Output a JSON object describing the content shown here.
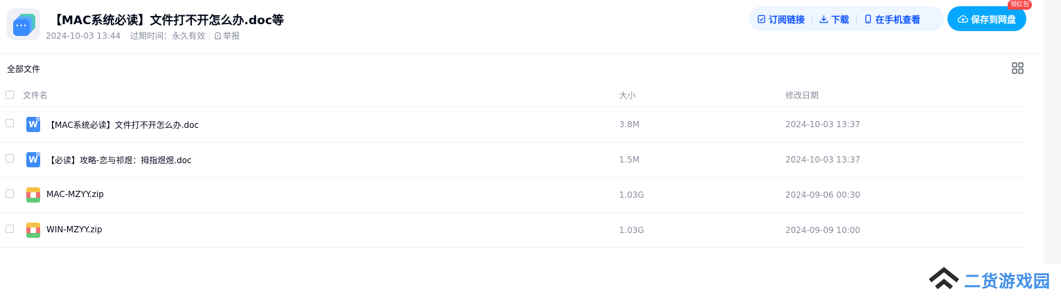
{
  "header": {
    "title": "【MAC系统必读】文件打不开怎么办.doc等",
    "share_date": "2024-10-03 13:44",
    "expiry_label": "过期时间：永久有效",
    "report_label": "举报"
  },
  "actions": {
    "subscribe_label": "订阅链接",
    "download_label": "下载",
    "phone_label": "在手机查看",
    "save_label": "保存到网盘",
    "badge_label": "领红包"
  },
  "toolbar": {
    "breadcrumb": "全部文件",
    "view_toggle_icon": "grid-icon"
  },
  "table": {
    "columns": {
      "name": "文件名",
      "size": "大小",
      "date": "修改日期"
    },
    "rows": [
      {
        "name": "【MAC系统必读】文件打不开怎么办.doc",
        "size": "3.8M",
        "date": "2024-10-03 13:37",
        "icon": "word-doc-icon"
      },
      {
        "name": "【必读】攻略-恋与祁煜：拇指煜煜.doc",
        "size": "1.5M",
        "date": "2024-10-03 13:37",
        "icon": "word-doc-icon"
      },
      {
        "name": "MAC-MZYY.zip",
        "size": "1.03G",
        "date": "2024-09-06 00:30",
        "icon": "zip-archive-icon"
      },
      {
        "name": "WIN-MZYY.zip",
        "size": "1.03G",
        "date": "2024-09-09 10:00",
        "icon": "zip-archive-icon"
      }
    ]
  },
  "watermark": {
    "text": "二货游戏园"
  },
  "colors": {
    "accent": "#06a7ff",
    "link_blue": "#0d53ff",
    "badge_red": "#f5484a",
    "muted": "#878c9c"
  }
}
